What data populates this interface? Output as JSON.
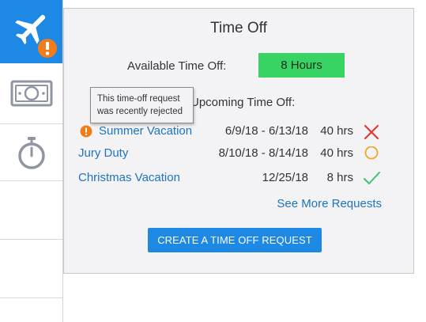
{
  "sidebar": {
    "items": [
      {
        "icon": "airplane-icon",
        "active": true,
        "badge_icon": "alert-icon"
      },
      {
        "icon": "money-icon",
        "active": false
      },
      {
        "icon": "stopwatch-icon",
        "active": false
      },
      {
        "icon": "",
        "active": false
      },
      {
        "icon": "",
        "active": false
      },
      {
        "icon": "",
        "active": false
      }
    ]
  },
  "panel": {
    "title": "Time Off",
    "available_label": "Available Time Off:",
    "available_value": "8 Hours",
    "upcoming_label": "Upcoming Time Off:",
    "requests": [
      {
        "name": "Summer Vacation",
        "dates": "6/9/18 - 6/13/18",
        "hours": "40 hrs",
        "status": "rejected",
        "status_icon": "x-icon",
        "alert": true
      },
      {
        "name": "Jury Duty",
        "dates": "8/10/18 - 8/14/18",
        "hours": "40 hrs",
        "status": "pending",
        "status_icon": "circle-icon"
      },
      {
        "name": "Christmas Vacation",
        "dates": "12/25/18",
        "hours": "8 hrs",
        "status": "approved",
        "status_icon": "checkmark-icon"
      }
    ],
    "see_more": "See More Requests",
    "create_button": "CREATE A TIME OFF REQUEST"
  },
  "tooltip": {
    "line1": "This time-off request",
    "line2": "was recently rejected"
  },
  "colors": {
    "accent": "#1e88e5",
    "link": "#1e73be",
    "available_bg": "#38d463",
    "rejected": "#e53935",
    "pending": "#f5a623",
    "approved": "#3cc46a",
    "alert": "#f07d1a"
  }
}
